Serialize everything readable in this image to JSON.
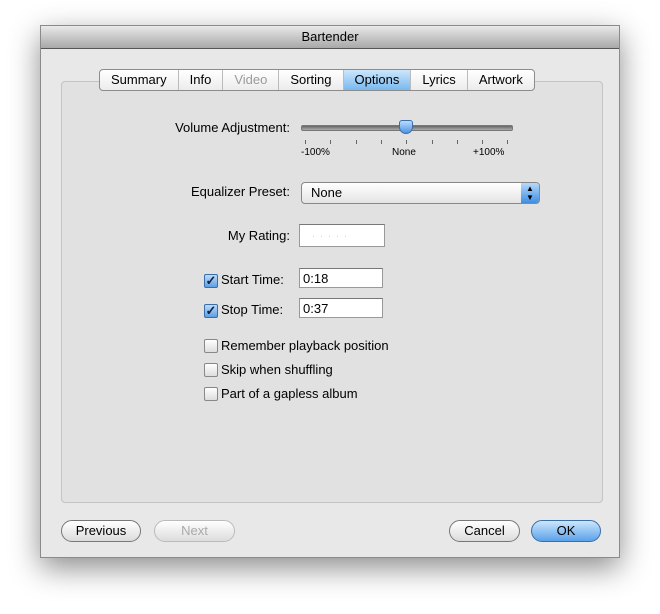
{
  "window": {
    "title": "Bartender"
  },
  "tabs": [
    {
      "label": "Summary"
    },
    {
      "label": "Info"
    },
    {
      "label": "Video"
    },
    {
      "label": "Sorting"
    },
    {
      "label": "Options"
    },
    {
      "label": "Lyrics"
    },
    {
      "label": "Artwork"
    }
  ],
  "selected_tab": "Options",
  "volume": {
    "label": "Volume Adjustment:",
    "min_label": "-100%",
    "mid_label": "None",
    "max_label": "+100%",
    "value_percent": 0
  },
  "equalizer": {
    "label": "Equalizer Preset:",
    "value": "None"
  },
  "rating": {
    "label": "My Rating:",
    "stars": 0
  },
  "start_time": {
    "label": "Start Time:",
    "value": "0:18",
    "checked": true
  },
  "stop_time": {
    "label": "Stop Time:",
    "value": "0:37",
    "checked": true
  },
  "options": [
    {
      "label": "Remember playback position",
      "checked": false
    },
    {
      "label": "Skip when shuffling",
      "checked": false
    },
    {
      "label": "Part of a gapless album",
      "checked": false
    }
  ],
  "buttons": {
    "previous": "Previous",
    "next": "Next",
    "cancel": "Cancel",
    "ok": "OK"
  },
  "colors": {
    "accent": "#5aa2ea"
  }
}
